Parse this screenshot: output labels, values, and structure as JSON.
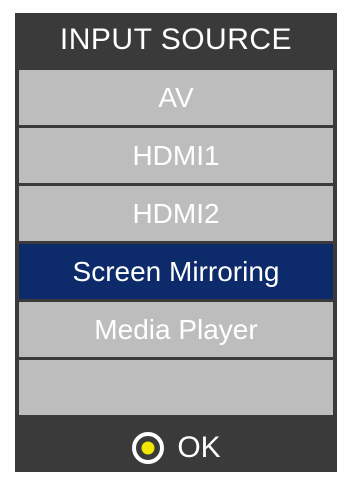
{
  "menu": {
    "title": "INPUT SOURCE",
    "items": [
      {
        "label": "AV",
        "selected": false
      },
      {
        "label": "HDMI1",
        "selected": false
      },
      {
        "label": "HDMI2",
        "selected": false
      },
      {
        "label": "Screen Mirroring",
        "selected": true
      },
      {
        "label": "Media Player",
        "selected": false
      },
      {
        "label": "",
        "selected": false
      }
    ]
  },
  "footer": {
    "ok_label": "OK",
    "ok_icon": "ok-button-icon"
  },
  "colors": {
    "panel_background": "#3a3a3a",
    "item_background": "#bdbdbd",
    "selected_background": "#0d2a6b",
    "text": "#ffffff",
    "ok_icon_center": "#f2e600"
  }
}
